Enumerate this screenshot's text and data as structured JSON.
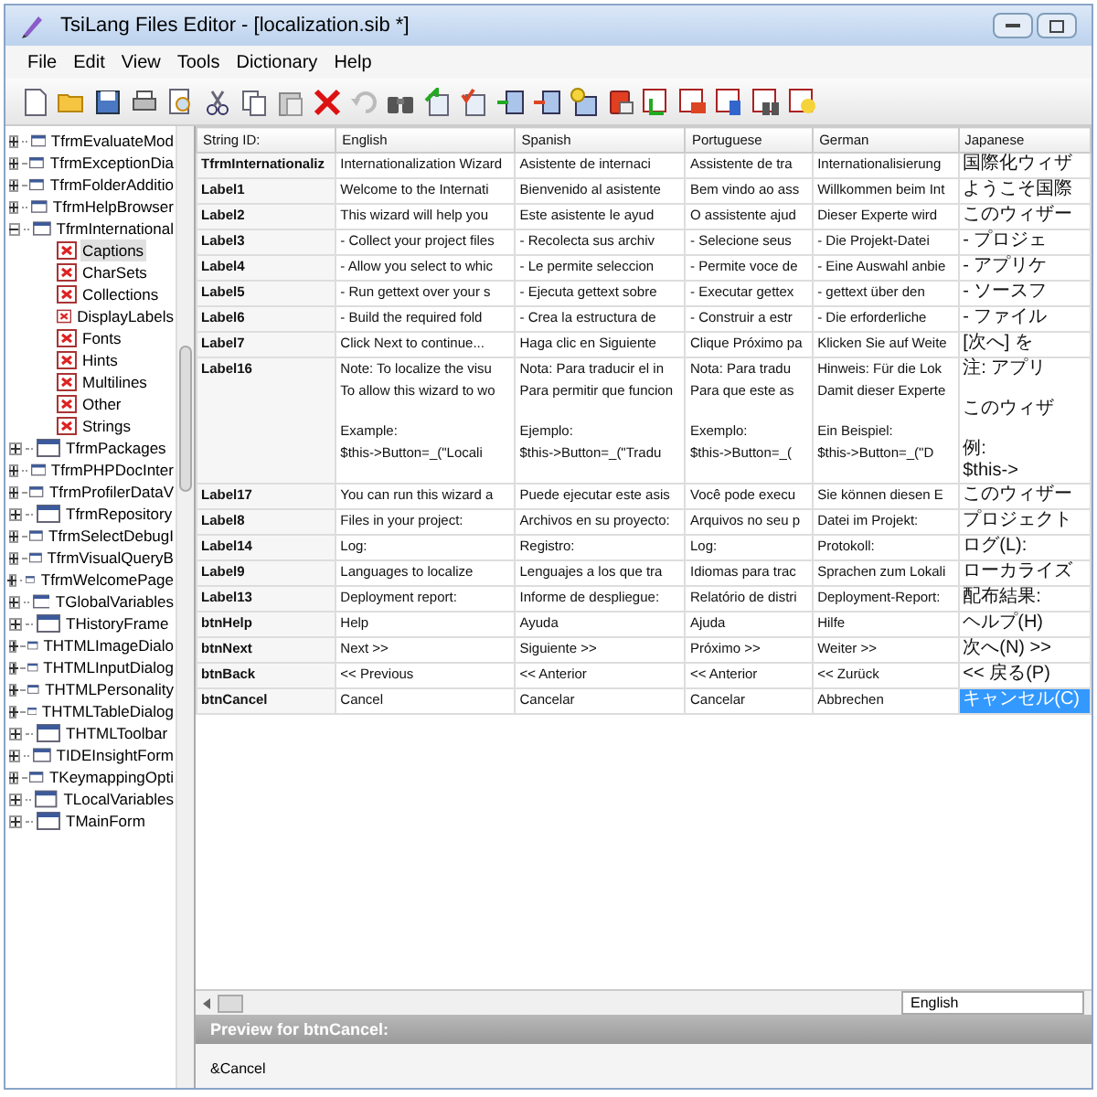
{
  "window": {
    "title": "TsiLang Files Editor - [localization.sib *]"
  },
  "menu": [
    {
      "label": "File"
    },
    {
      "label": "Edit"
    },
    {
      "label": "View"
    },
    {
      "label": "Tools"
    },
    {
      "label": "Dictionary"
    },
    {
      "label": "Help"
    }
  ],
  "tree": [
    {
      "label": "TfrmEvaluateMod",
      "expanded": false
    },
    {
      "label": "TfrmExceptionDia",
      "expanded": false
    },
    {
      "label": "TfrmFolderAdditio",
      "expanded": false
    },
    {
      "label": "TfrmHelpBrowser",
      "expanded": false
    },
    {
      "label": "TfrmInternational",
      "expanded": true,
      "children": [
        {
          "label": "Captions",
          "selected": true
        },
        {
          "label": "CharSets",
          "selected": false
        },
        {
          "label": "Collections",
          "selected": false
        },
        {
          "label": "DisplayLabels",
          "selected": false
        },
        {
          "label": "Fonts",
          "selected": false
        },
        {
          "label": "Hints",
          "selected": false
        },
        {
          "label": "Multilines",
          "selected": false
        },
        {
          "label": "Other",
          "selected": false
        },
        {
          "label": "Strings",
          "selected": false
        }
      ]
    },
    {
      "label": "TfrmPackages",
      "expanded": false
    },
    {
      "label": "TfrmPHPDocInter",
      "expanded": false
    },
    {
      "label": "TfrmProfilerDataV",
      "expanded": false
    },
    {
      "label": "TfrmRepository",
      "expanded": false
    },
    {
      "label": "TfrmSelectDebugI",
      "expanded": false
    },
    {
      "label": "TfrmVisualQueryB",
      "expanded": false
    },
    {
      "label": "TfrmWelcomePage",
      "expanded": false
    },
    {
      "label": "TGlobalVariables",
      "expanded": false
    },
    {
      "label": "THistoryFrame",
      "expanded": false
    },
    {
      "label": "THTMLImageDialo",
      "expanded": false
    },
    {
      "label": "THTMLInputDialog",
      "expanded": false
    },
    {
      "label": "THTMLPersonality",
      "expanded": false
    },
    {
      "label": "THTMLTableDialog",
      "expanded": false
    },
    {
      "label": "THTMLToolbar",
      "expanded": false
    },
    {
      "label": "TIDEInsightForm",
      "expanded": false
    },
    {
      "label": "TKeymappingOpti",
      "expanded": false
    },
    {
      "label": "TLocalVariables",
      "expanded": false
    },
    {
      "label": "TMainForm",
      "expanded": false
    }
  ],
  "table": {
    "columns": [
      "String ID:",
      "English",
      "Spanish",
      "Portuguese",
      "German",
      "Japanese"
    ],
    "rows": [
      {
        "cells": [
          {
            "text": "TfrmInternationaliz",
            "selected": false
          },
          {
            "text": "Internationalization Wizard",
            "selected": false
          },
          {
            "text": "Asistente de internaci",
            "selected": false
          },
          {
            "text": "Assistente de tra",
            "selected": false
          },
          {
            "text": "Internationalisierung",
            "selected": false
          },
          {
            "text": "国際化ウィザ",
            "selected": false
          }
        ]
      },
      {
        "cells": [
          {
            "text": "Label1",
            "selected": false
          },
          {
            "text": "Welcome to the Internati",
            "selected": false
          },
          {
            "text": "Bienvenido al asistente",
            "selected": false
          },
          {
            "text": "Bem vindo ao ass",
            "selected": false
          },
          {
            "text": "Willkommen beim Int",
            "selected": false
          },
          {
            "text": "ようこそ国際",
            "selected": false
          }
        ]
      },
      {
        "cells": [
          {
            "text": "Label2",
            "selected": false
          },
          {
            "text": "This wizard will help you",
            "selected": false
          },
          {
            "text": "Este asistente le ayud",
            "selected": false
          },
          {
            "text": "O assistente ajud",
            "selected": false
          },
          {
            "text": "Dieser Experte wird",
            "selected": false
          },
          {
            "text": "このウィザー",
            "selected": false
          }
        ]
      },
      {
        "cells": [
          {
            "text": "Label3",
            "selected": false
          },
          {
            "text": "- Collect your project files",
            "selected": false
          },
          {
            "text": "- Recolecta sus archiv",
            "selected": false
          },
          {
            "text": "- Selecione seus",
            "selected": false
          },
          {
            "text": "- Die Projekt-Datei",
            "selected": false
          },
          {
            "text": "- プロジェ",
            "selected": false
          }
        ]
      },
      {
        "cells": [
          {
            "text": "Label4",
            "selected": false
          },
          {
            "text": "- Allow you select to whic",
            "selected": false
          },
          {
            "text": "- Le permite seleccion",
            "selected": false
          },
          {
            "text": "- Permite voce de",
            "selected": false
          },
          {
            "text": "- Eine Auswahl anbie",
            "selected": false
          },
          {
            "text": "- アプリケ",
            "selected": false
          }
        ]
      },
      {
        "cells": [
          {
            "text": "Label5",
            "selected": false
          },
          {
            "text": "- Run gettext over your s",
            "selected": false
          },
          {
            "text": "- Ejecuta gettext sobre",
            "selected": false
          },
          {
            "text": "- Executar gettex",
            "selected": false
          },
          {
            "text": "- gettext über den",
            "selected": false
          },
          {
            "text": "- ソースフ",
            "selected": false
          }
        ]
      },
      {
        "cells": [
          {
            "text": "Label6",
            "selected": false
          },
          {
            "text": "- Build the required fold",
            "selected": false
          },
          {
            "text": "- Crea la estructura de",
            "selected": false
          },
          {
            "text": "- Construir a estr",
            "selected": false
          },
          {
            "text": "- Die erforderliche",
            "selected": false
          },
          {
            "text": "- ファイル",
            "selected": false
          }
        ]
      },
      {
        "cells": [
          {
            "text": "Label7",
            "selected": false
          },
          {
            "text": "Click Next to continue...",
            "selected": false
          },
          {
            "text": "Haga clic en Siguiente",
            "selected": false
          },
          {
            "text": "Clique Próximo pa",
            "selected": false
          },
          {
            "text": "Klicken Sie auf Weite",
            "selected": false
          },
          {
            "text": "[次へ] を",
            "selected": false
          }
        ]
      },
      {
        "cells": [
          {
            "text": "Label16",
            "selected": false
          },
          {
            "paragraphs": [
              [
                "Note: To localize the visu",
                "To allow this wizard to wo"
              ],
              [
                "Example:",
                "$this->Button=_(\"Locali"
              ]
            ],
            "selected": false
          },
          {
            "paragraphs": [
              [
                "Nota: Para traducir el in",
                "Para permitir que funcion"
              ],
              [
                "Ejemplo:",
                "$this->Button=_(\"Tradu"
              ]
            ],
            "selected": false
          },
          {
            "paragraphs": [
              [
                "Nota: Para tradu",
                "Para que este as"
              ],
              [
                "Exemplo:",
                "$this->Button=_("
              ]
            ],
            "selected": false
          },
          {
            "paragraphs": [
              [
                "Hinweis: Für die Lok",
                "Damit dieser Experte"
              ],
              [
                "Ein Beispiel:",
                "$this->Button=_(\"D"
              ]
            ],
            "selected": false
          },
          {
            "paragraphs": [
              [
                "注: アプリ"
              ],
              [
                "このウィザ"
              ],
              [
                "例:",
                "$this->"
              ]
            ],
            "selected": false
          }
        ]
      },
      {
        "cells": [
          {
            "text": "Label17",
            "selected": false
          },
          {
            "text": "You can run this wizard a",
            "selected": false
          },
          {
            "text": "Puede ejecutar este asis",
            "selected": false
          },
          {
            "text": "Você pode execu",
            "selected": false
          },
          {
            "text": "Sie können diesen E",
            "selected": false
          },
          {
            "text": "このウィザー",
            "selected": false
          }
        ]
      },
      {
        "cells": [
          {
            "text": "Label8",
            "selected": false
          },
          {
            "text": "Files in your project:",
            "selected": false
          },
          {
            "text": "Archivos en su proyecto:",
            "selected": false
          },
          {
            "text": "Arquivos no seu p",
            "selected": false
          },
          {
            "text": "Datei im Projekt:",
            "selected": false
          },
          {
            "text": "プロジェクト",
            "selected": false
          }
        ]
      },
      {
        "cells": [
          {
            "text": "Label14",
            "selected": false
          },
          {
            "text": "Log:",
            "selected": false
          },
          {
            "text": "Registro:",
            "selected": false
          },
          {
            "text": "Log:",
            "selected": false
          },
          {
            "text": "Protokoll:",
            "selected": false
          },
          {
            "text": "ログ(L):",
            "selected": false
          }
        ]
      },
      {
        "cells": [
          {
            "text": "Label9",
            "selected": false
          },
          {
            "text": "Languages to localize",
            "selected": false
          },
          {
            "text": "Lenguajes a los que tra",
            "selected": false
          },
          {
            "text": "Idiomas para trac",
            "selected": false
          },
          {
            "text": "Sprachen zum Lokali",
            "selected": false
          },
          {
            "text": "ローカライズ",
            "selected": false
          }
        ]
      },
      {
        "cells": [
          {
            "text": "Label13",
            "selected": false
          },
          {
            "text": "Deployment report:",
            "selected": false
          },
          {
            "text": "Informe de despliegue:",
            "selected": false
          },
          {
            "text": "Relatório de distri",
            "selected": false
          },
          {
            "text": "Deployment-Report:",
            "selected": false
          },
          {
            "text": "配布結果:",
            "selected": false
          }
        ]
      },
      {
        "cells": [
          {
            "text": "btnHelp",
            "selected": false
          },
          {
            "text": "Help",
            "selected": false
          },
          {
            "text": "Ayuda",
            "selected": false
          },
          {
            "text": "Ajuda",
            "selected": false
          },
          {
            "text": "Hilfe",
            "selected": false
          },
          {
            "text": "ヘルプ(H)",
            "selected": false
          }
        ]
      },
      {
        "cells": [
          {
            "text": "btnNext",
            "selected": false
          },
          {
            "text": "Next >>",
            "selected": false
          },
          {
            "text": "Siguiente >>",
            "selected": false
          },
          {
            "text": "Próximo >>",
            "selected": false
          },
          {
            "text": "Weiter >>",
            "selected": false
          },
          {
            "text": "次へ(N) >>",
            "selected": false
          }
        ]
      },
      {
        "cells": [
          {
            "text": "btnBack",
            "selected": false
          },
          {
            "text": "<< Previous",
            "selected": false
          },
          {
            "text": "<< Anterior",
            "selected": false
          },
          {
            "text": "<< Anterior",
            "selected": false
          },
          {
            "text": "<< Zurück",
            "selected": false
          },
          {
            "text": "<< 戻る(P)",
            "selected": false
          }
        ]
      },
      {
        "cells": [
          {
            "text": "btnCancel",
            "selected": false
          },
          {
            "text": "Cancel",
            "selected": false
          },
          {
            "text": "Cancelar",
            "selected": false
          },
          {
            "text": "Cancelar",
            "selected": false
          },
          {
            "text": "Abbrechen",
            "selected": false
          },
          {
            "text": "キャンセル(C)",
            "selected": true
          }
        ]
      }
    ]
  },
  "language_select": {
    "value": "English"
  },
  "preview": {
    "title": "Preview for btnCancel:",
    "text": "&Cancel"
  }
}
